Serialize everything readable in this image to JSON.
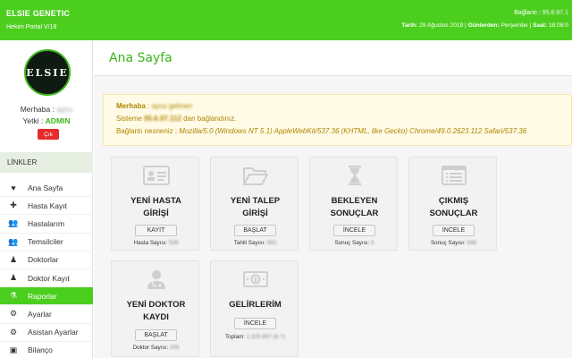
{
  "header": {
    "brand": "ELSIE GENETIC",
    "portal": "Hekim Portal V/18",
    "connection_label": "Bağlantı : ",
    "connection_value": "95.6.97.1",
    "date_label": "Tarih:",
    "date_value": " 29 Ağustos 2019 | ",
    "weekday_label": "Günlerden:",
    "weekday_value": " Perşembe | ",
    "time_label": "Saat:",
    "time_value": " 18:08:0"
  },
  "sidebar": {
    "logo_text": "ELSIE",
    "greeting_label": "Merhaba : ",
    "greeting_name": "aycu",
    "role_label": "Yetki : ",
    "role_value": "ADMIN",
    "logout_label": "Çık",
    "links_heading": "LİNKLER",
    "items": [
      {
        "label": "Ana Sayfa",
        "icon": "♥"
      },
      {
        "label": "Hasta Kayıt",
        "icon": "✚"
      },
      {
        "label": "Hastalarım",
        "icon": "👥"
      },
      {
        "label": "Temsilciler",
        "icon": "👥"
      },
      {
        "label": "Doktorlar",
        "icon": "♟"
      },
      {
        "label": "Doktor Kayıt",
        "icon": "♟"
      },
      {
        "label": "Raporlar",
        "icon": "⚗"
      },
      {
        "label": "Ayarlar",
        "icon": "⚙"
      },
      {
        "label": "Asistan Ayarlar",
        "icon": "⚙"
      },
      {
        "label": "Bilanço",
        "icon": "▣"
      }
    ]
  },
  "main": {
    "title": "Ana Sayfa",
    "info": {
      "greeting_label": "Merhaba",
      "greeting_sep": " : ",
      "greeting_name": "aycu gelmen",
      "line2_prefix": "Sisteme ",
      "ip": "95.6.97.112",
      "line2_suffix": " dan bağlandınız.",
      "line3_prefix": "Bağlantı nesneniz ; ",
      "user_agent": "Mozilla/5.0 (Windows NT 5.1) AppleWebKit/537.36 (KHTML, like Gecko) Chrome/49.0.2623.112 Safari/537.36"
    },
    "cards": [
      {
        "title1": "YENİ HASTA",
        "title2": "GİRİŞİ",
        "button": "KAYIT",
        "foot_label": "Hasta Sayısı: ",
        "foot_value": "539"
      },
      {
        "title1": "YENİ TALEP",
        "title2": "GİRİŞİ",
        "button": "BAŞLAT",
        "foot_label": "Tahlil Sayısı: ",
        "foot_value": "950"
      },
      {
        "title1": "BEKLEYEN",
        "title2": "SONUÇLAR",
        "button": "İNCELE",
        "foot_label": "Sonuç Sayısı: ",
        "foot_value": "8"
      },
      {
        "title1": "ÇIKMIŞ",
        "title2": "SONUÇLAR",
        "button": "İNCELE",
        "foot_label": "Sonuç Sayısı: ",
        "foot_value": "948"
      },
      {
        "title1": "YENİ DOKTOR",
        "title2": "KAYDI",
        "button": "BAŞLAT",
        "foot_label": "Doktor Sayısı: ",
        "foot_value": "209"
      },
      {
        "title1": "GELİRLERİM",
        "title2": "",
        "button": "İNCELE",
        "foot_label": "Toplam: ",
        "foot_value": "1.326.897 (₺ ?)"
      }
    ]
  }
}
